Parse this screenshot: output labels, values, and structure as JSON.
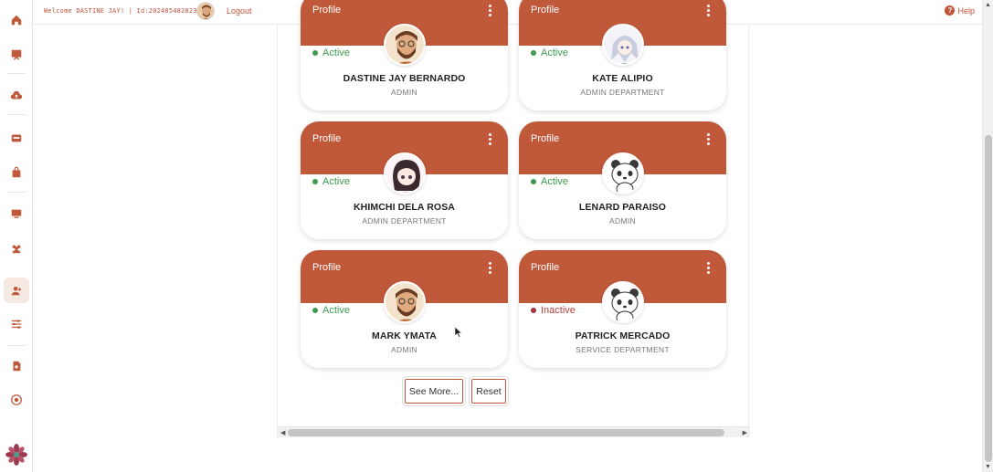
{
  "header": {
    "welcome_text": "Welcome DASTINE JAY! | Id:202405482823",
    "logout_label": "Logout",
    "help_label": "Help"
  },
  "sidebar": {
    "items": [
      {
        "icon": "home-icon"
      },
      {
        "icon": "presentation-icon"
      },
      {
        "icon": "cloud-upload-icon"
      },
      {
        "icon": "inbox-icon"
      },
      {
        "icon": "bag-icon"
      },
      {
        "icon": "monitor-icon"
      },
      {
        "icon": "users-icon"
      },
      {
        "icon": "user-add-icon"
      },
      {
        "icon": "sliders-icon"
      },
      {
        "icon": "document-icon"
      },
      {
        "icon": "target-icon"
      }
    ],
    "logo_icon": "flower-logo-icon",
    "active_item": "user-add-icon"
  },
  "cards": [
    {
      "title": "Profile",
      "status": "Active",
      "name": "DASTINE JAY BERNARDO",
      "role": "ADMIN",
      "avatar": "bearded-man-avatar"
    },
    {
      "title": "Profile",
      "status": "Active",
      "name": "KATE ALIPIO",
      "role": "ADMIN DEPARTMENT",
      "avatar": "anime-girl-avatar"
    },
    {
      "title": "Profile",
      "status": "Active",
      "name": "KHIMCHI DELA ROSA",
      "role": "ADMIN DEPARTMENT",
      "avatar": "chibi-girl-avatar"
    },
    {
      "title": "Profile",
      "status": "Active",
      "name": "LENARD PARAISO",
      "role": "ADMIN",
      "avatar": "panda-avatar"
    },
    {
      "title": "Profile",
      "status": "Active",
      "name": "MARK YMATA",
      "role": "ADMIN",
      "avatar": "bearded-man-avatar"
    },
    {
      "title": "Profile",
      "status": "Inactive",
      "name": "PATRICK MERCADO",
      "role": "SERVICE DEPARTMENT",
      "avatar": "panda-avatar"
    }
  ],
  "buttons": {
    "see_more": "See More...",
    "reset": "Reset"
  },
  "colors": {
    "accent": "#c0583a",
    "active_green": "#3d9b4f",
    "inactive_red": "#a8323a"
  }
}
